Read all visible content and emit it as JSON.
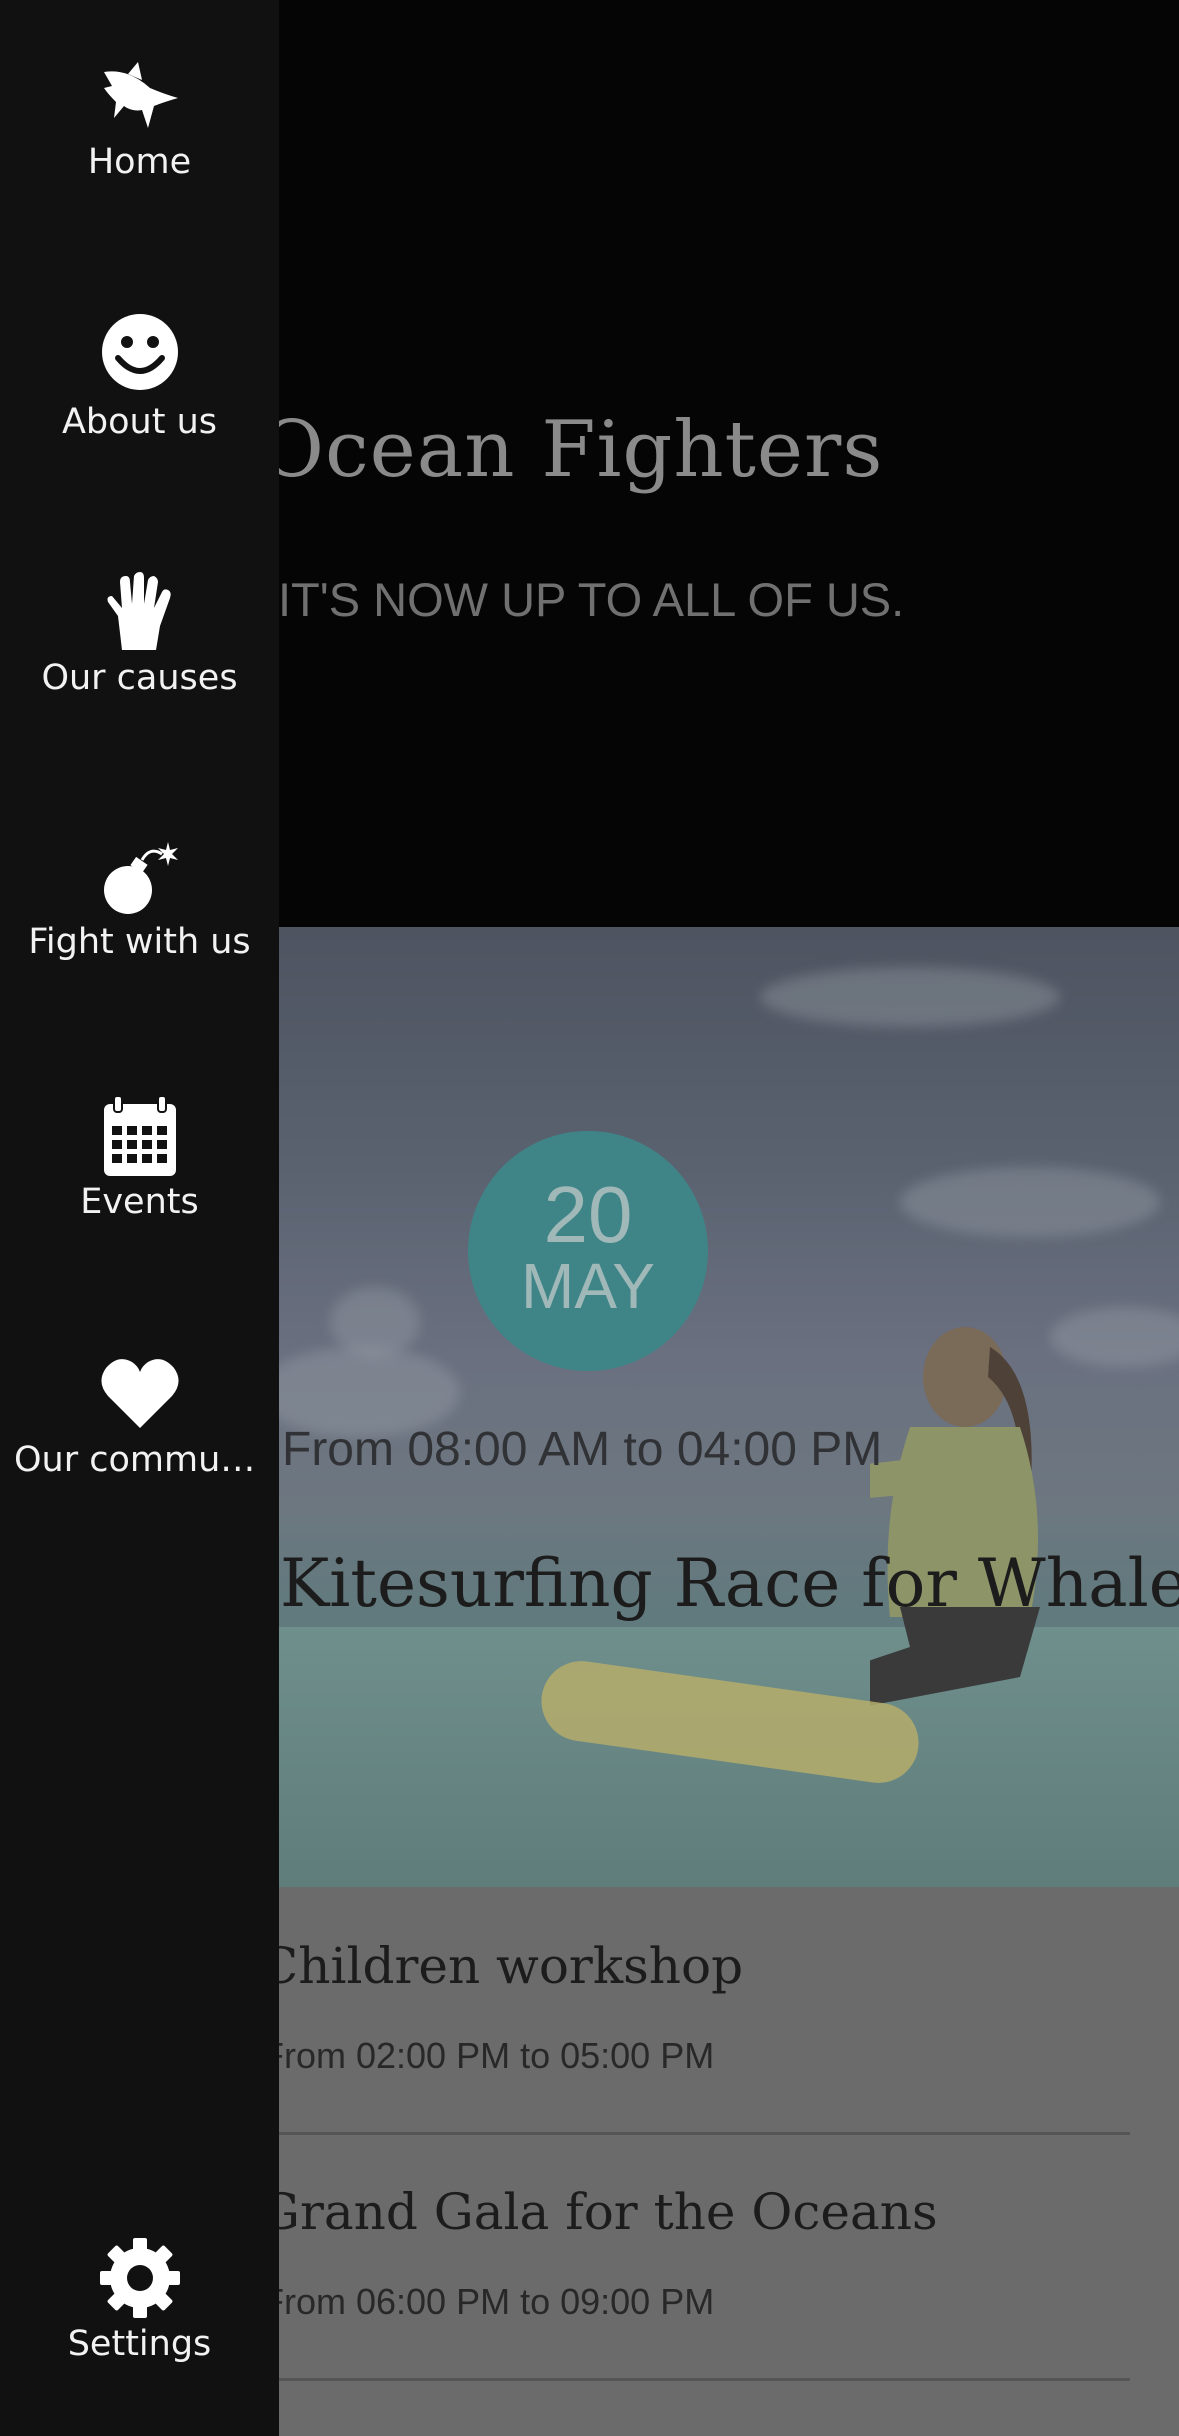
{
  "hero": {
    "title": "Ocean Fighters",
    "subtitle": "IT'S NOW UP TO ALL OF US."
  },
  "featured_event": {
    "day": "20",
    "month": "MAY",
    "time": "From 08:00 AM to 04:00 PM",
    "title": "Kitesurfing Race for Whales",
    "circle_color": "#3f8588"
  },
  "events": [
    {
      "title": "Children workshop",
      "time": "From 02:00 PM to 05:00 PM"
    },
    {
      "title": "Grand Gala for the Oceans",
      "time": "From 06:00 PM to 09:00 PM"
    }
  ],
  "drawer": {
    "background": "#111111",
    "items": [
      {
        "label": "Home",
        "icon": "shark-icon"
      },
      {
        "label": "About us",
        "icon": "smiley-icon"
      },
      {
        "label": "Our causes",
        "icon": "hand-icon"
      },
      {
        "label": "Fight with us",
        "icon": "bomb-icon"
      },
      {
        "label": "Events",
        "icon": "calendar-icon"
      },
      {
        "label": "Our community",
        "icon": "heart-icon"
      }
    ],
    "settings": {
      "label": "Settings",
      "icon": "gear-icon"
    }
  }
}
